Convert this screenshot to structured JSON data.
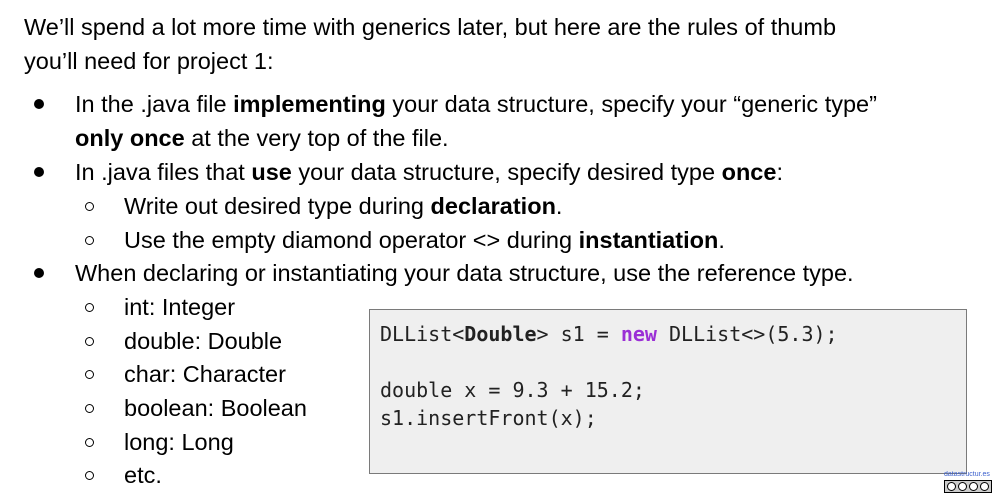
{
  "intro": {
    "line1": "We’ll spend a lot more time with generics later, but here are the rules of thumb",
    "line2": "you’ll need for project 1:"
  },
  "rule1": {
    "pre": "In the .java file ",
    "bold1": "implementing",
    "mid": " your data structure, specify your “generic type”",
    "bold2": "only once",
    "post": " at the very top of the file."
  },
  "rule2": {
    "pre": "In .java files that ",
    "bold1": "use",
    "mid": " your data structure, specify desired type ",
    "bold2": "once",
    "post": ":",
    "sub1_pre": "Write out desired type during ",
    "sub1_bold": "declaration",
    "sub1_post": ".",
    "sub2_pre": "Use the empty diamond operator <> during ",
    "sub2_bold": "instantiation",
    "sub2_post": "."
  },
  "rule3": {
    "text": "When declaring or instantiating your data structure, use the reference type.",
    "items": [
      "int: Integer",
      "double: Double",
      "char: Character",
      "boolean: Boolean",
      "long: Long",
      "etc."
    ]
  },
  "code": {
    "line1_a": "DLList<",
    "line1_type": "Double",
    "line1_b": "> s1 = ",
    "line1_kw": "new",
    "line1_c": " DLList<>(5.3);",
    "line2": "double x = 9.3 + 15.2;",
    "line3": "s1.insertFront(x);"
  },
  "credit": "datastructur.es"
}
